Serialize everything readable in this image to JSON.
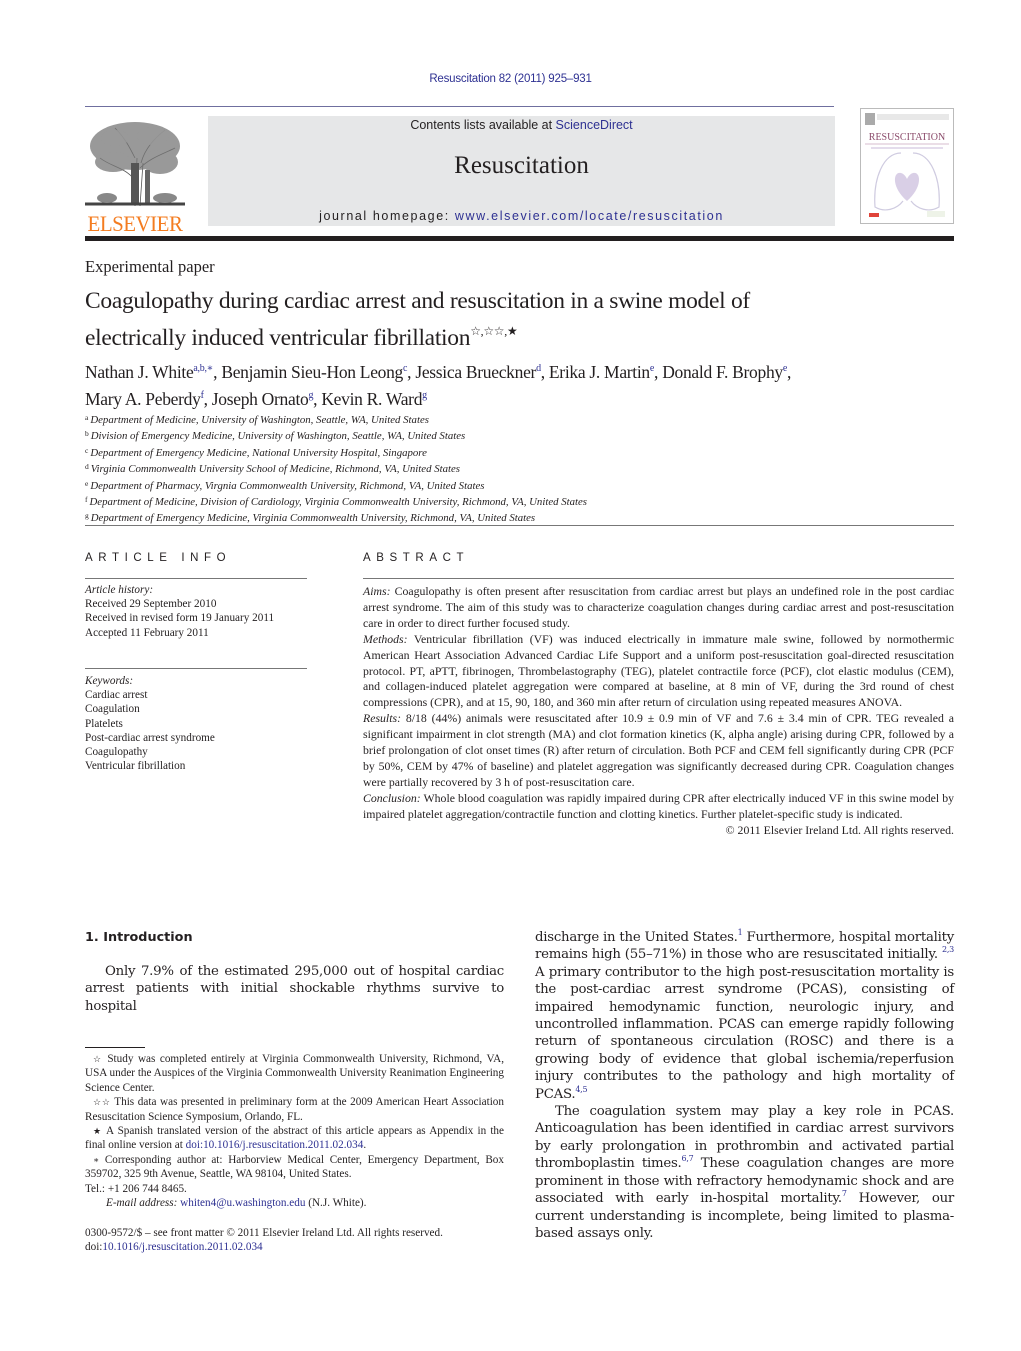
{
  "header": {
    "citation": "Resuscitation 82 (2011) 925–931",
    "contents_prefix": "Contents lists available at ",
    "contents_link": "ScienceDirect",
    "journal_title": "Resuscitation",
    "homepage_prefix": "journal homepage: ",
    "homepage_url": "www.elsevier.com/locate/resuscitation",
    "publisher_logo_text": "ELSEVIER",
    "cover_title": "RESUSCITATION"
  },
  "colors": {
    "link": "#2e3192",
    "elsevier_orange": "#f47c20",
    "masthead_bg": "#e6e7e8"
  },
  "article": {
    "type": "Experimental paper",
    "title_line1": "Coagulopathy during cardiac arrest and resuscitation in a swine model of",
    "title_line2": "electrically induced ventricular fibrillation",
    "title_marks": "☆,☆☆,★",
    "authors": [
      {
        "name": "Nathan J. White",
        "sup": "a,b,∗",
        "sep": ", "
      },
      {
        "name": "Benjamin Sieu-Hon Leong",
        "sup": "c",
        "sep": ", "
      },
      {
        "name": "Jessica Brueckner",
        "sup": "d",
        "sep": ", "
      },
      {
        "name": "Erika J. Martin",
        "sup": "e",
        "sep": ", "
      },
      {
        "name": "Donald F. Brophy",
        "sup": "e",
        "sep": ","
      },
      {
        "name": "Mary A. Peberdy",
        "sup": "f",
        "sep": ", "
      },
      {
        "name": "Joseph Ornato",
        "sup": "g",
        "sep": ", "
      },
      {
        "name": "Kevin R. Ward",
        "sup": "g",
        "sep": ""
      }
    ],
    "affiliations": [
      {
        "key": "a",
        "text": "Department of Medicine, University of Washington, Seattle, WA, United States"
      },
      {
        "key": "b",
        "text": "Division of Emergency Medicine, University of Washington, Seattle, WA, United States"
      },
      {
        "key": "c",
        "text": "Department of Emergency Medicine, National University Hospital, Singapore"
      },
      {
        "key": "d",
        "text": "Virginia Commonwealth University School of Medicine, Richmond, VA, United States"
      },
      {
        "key": "e",
        "text": "Department of Pharmacy, Virgnia Commonwealth University, Richmond, VA, United States"
      },
      {
        "key": "f",
        "text": "Department of Medicine, Division of Cardiology, Virginia Commonwealth University, Richmond, VA, United States"
      },
      {
        "key": "g",
        "text": "Department of Emergency Medicine, Virginia Commonwealth University, Richmond, VA, United States"
      }
    ]
  },
  "article_info": {
    "heading": "ARTICLE INFO",
    "history_label": "Article history:",
    "history": [
      "Received 29 September 2010",
      "Received in revised form 19 January 2011",
      "Accepted 11 February 2011"
    ],
    "keywords_label": "Keywords:",
    "keywords": [
      "Cardiac arrest",
      "Coagulation",
      "Platelets",
      "Post-cardiac arrest syndrome",
      "Coagulopathy",
      "Ventricular fibrillation"
    ]
  },
  "abstract": {
    "heading": "ABSTRACT",
    "sections": [
      {
        "label": "Aims:",
        "text": " Coagulopathy is often present after resuscitation from cardiac arrest but plays an undefined role in the post cardiac arrest syndrome. The aim of this study was to characterize coagulation changes during cardiac arrest and post-resuscitation care in order to direct further focused study."
      },
      {
        "label": "Methods:",
        "text": " Ventricular fibrillation (VF) was induced electrically in immature male swine, followed by normothermic American Heart Association Advanced Cardiac Life Support and a uniform post-resuscitation goal-directed resuscitation protocol. PT, aPTT, fibrinogen, Thrombelastography (TEG), platelet contractile force (PCF), clot elastic modulus (CEM), and collagen-induced platelet aggregation were compared at baseline, at 8 min of VF, during the 3rd round of chest compressions (CPR), and at 15, 90, 180, and 360 min after return of circulation using repeated measures ANOVA."
      },
      {
        "label": "Results:",
        "text": " 8/18 (44%) animals were resuscitated after 10.9 ± 0.9 min of VF and 7.6 ± 3.4 min of CPR. TEG revealed a significant impairment in clot strength (MA) and clot formation kinetics (K, alpha angle) arising during CPR, followed by a brief prolongation of clot onset times (R) after return of circulation. Both PCF and CEM fell significantly during CPR (PCF by 50%, CEM by 47% of baseline) and platelet aggregation was significantly decreased during CPR. Coagulation changes were partially recovered by 3 h of post-resuscitation care."
      },
      {
        "label": "Conclusion:",
        "text": " Whole blood coagulation was rapidly impaired during CPR after electrically induced VF in this swine model by impaired platelet aggregation/contractile function and clotting kinetics. Further platelet-specific study is indicated."
      }
    ],
    "copyright": "© 2011 Elsevier Ireland Ltd. All rights reserved."
  },
  "body": {
    "section_heading": "1.  Introduction",
    "left_para": "Only 7.9% of the estimated 295,000 out of hospital cardiac arrest patients with initial shockable rhythms survive to hospital",
    "right_para1": [
      {
        "t": "discharge in the United States."
      },
      {
        "sup": "1"
      },
      {
        "t": " Furthermore, hospital mortality remains high (55–71%) in those who are resuscitated initially. "
      },
      {
        "sup": "2,3"
      },
      {
        "t": " A primary contributor to the high post-resuscitation mortality is the post-cardiac arrest syndrome (PCAS), consisting of impaired hemodynamic function, neurologic injury, and uncontrolled inflammation. PCAS can emerge rapidly following return of spontaneous circulation (ROSC) and there is a growing body of evidence that global ischemia/reperfusion injury contributes to the pathology and high mortality of PCAS."
      },
      {
        "sup": "4,5"
      }
    ],
    "right_para2": [
      {
        "t": "The coagulation system may play a key role in PCAS. Anticoagulation has been identified in cardiac arrest survivors by early prolongation in prothrombin and activated partial thromboplastin times."
      },
      {
        "sup": "6,7"
      },
      {
        "t": " These coagulation changes are more prominent in those with refractory hemodynamic shock and are associated with early in-hospital mortality."
      },
      {
        "sup": "7"
      },
      {
        "t": " However, our current understanding is incomplete, being limited to plasma-based assays only."
      }
    ]
  },
  "footnotes": {
    "fn1_mark": "☆",
    "fn1": " Study was completed entirely at Virginia Commonwealth University, Richmond, VA, USA under the Auspices of the Virginia Commonwealth University Reanimation Engineering Science Center.",
    "fn2_mark": "☆☆",
    "fn2": " This data was presented in preliminary form at the 2009 American Heart Association Resuscitation Science Symposium, Orlando, FL.",
    "fn3_mark": "★",
    "fn3": " A Spanish translated version of the abstract of this article appears as Appendix in the final online version at ",
    "fn3_link": "doi:10.1016/j.resuscitation.2011.02.034",
    "fn3_end": ".",
    "fn4_mark": "∗",
    "fn4": " Corresponding author at: Harborview Medical Center, Emergency Department, Box 359702, 325 9th Avenue, Seattle, WA 98104, United States.",
    "tel": "Tel.: +1 206 744 8465.",
    "email_label": "E-mail address:",
    "email": "whiten4@u.washington.edu",
    "email_suffix": " (N.J. White)."
  },
  "front_matter": {
    "issn_line": "0300-9572/$ – see front matter © 2011 Elsevier Ireland Ltd. All rights reserved.",
    "doi_prefix": "doi:",
    "doi": "10.1016/j.resuscitation.2011.02.034"
  }
}
